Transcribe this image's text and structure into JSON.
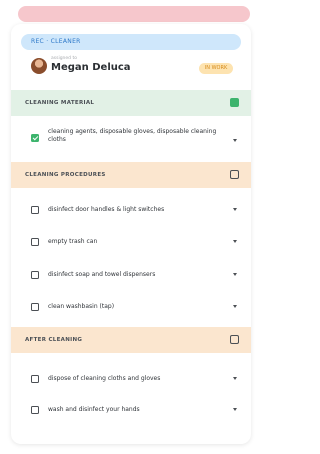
{
  "header_strip": {
    "color": "#f6c7cc"
  },
  "chip": {
    "label": "REC · CLEANER"
  },
  "user": {
    "subtitle": "assigned to",
    "name": "Megan Deluca",
    "status": "IN WORK"
  },
  "sections": [
    {
      "title": "CLEANING MATERIAL",
      "checked": true,
      "items": [
        {
          "label": "cleaning agents, disposable gloves, disposable cleaning cloths",
          "checked": true
        }
      ]
    },
    {
      "title": "CLEANING PROCEDURES",
      "checked": false,
      "items": [
        {
          "label": "disinfect door handles & light switches",
          "checked": false
        },
        {
          "label": "empty trash can",
          "checked": false
        },
        {
          "label": "disinfect soap and towel dispensers",
          "checked": false
        },
        {
          "label": "clean washbasin (tap)",
          "checked": false
        }
      ]
    },
    {
      "title": "AFTER CLEANING",
      "checked": false,
      "items": [
        {
          "label": "dispose of cleaning cloths and gloves",
          "checked": false
        },
        {
          "label": "wash and disinfect your hands",
          "checked": false
        }
      ]
    }
  ],
  "colors": {
    "accent_green": "#3db46d",
    "section_green_bg": "#e2f1e6",
    "section_orange_bg": "#fbe6cf",
    "chip_blue": "#cfe7fb",
    "status_orange": "#fde3b0"
  }
}
